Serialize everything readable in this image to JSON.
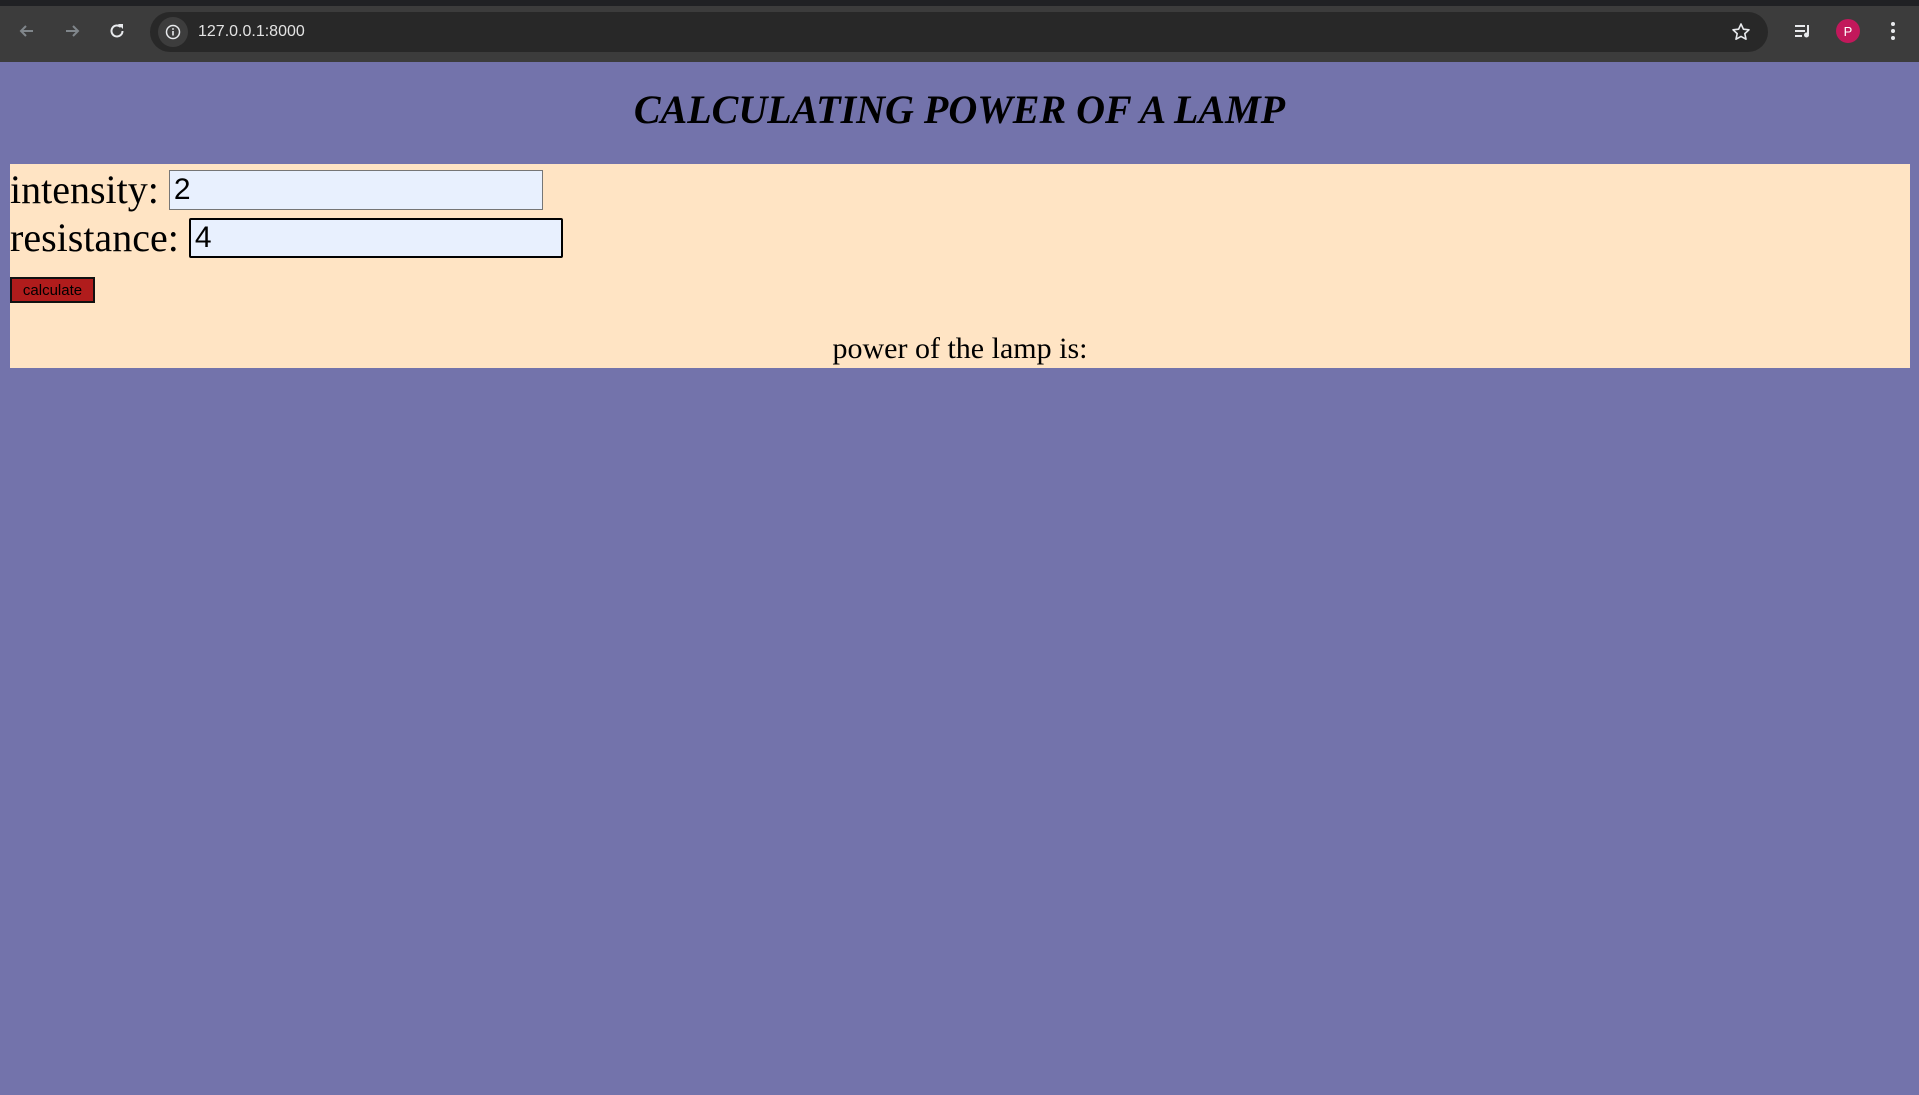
{
  "browser": {
    "url": "127.0.0.1:8000",
    "profile_initial": "P",
    "icons": {
      "back": "arrow-left-icon",
      "forward": "arrow-right-icon",
      "reload": "reload-icon",
      "site_info": "info-icon",
      "bookmark": "star-icon",
      "media": "media-control-icon",
      "menu": "kebab-menu-icon"
    }
  },
  "page": {
    "title": "CALCULATING POWER OF A LAMP",
    "background_color": "#7373ab",
    "panel_color": "#ffe4c4"
  },
  "form": {
    "intensity_label": "intensity:",
    "intensity_value": "2",
    "resistance_label": "resistance:",
    "resistance_value": "4",
    "calculate_label": "calculate",
    "button_color": "#b01c1c",
    "result_text": "power of the lamp is:"
  }
}
